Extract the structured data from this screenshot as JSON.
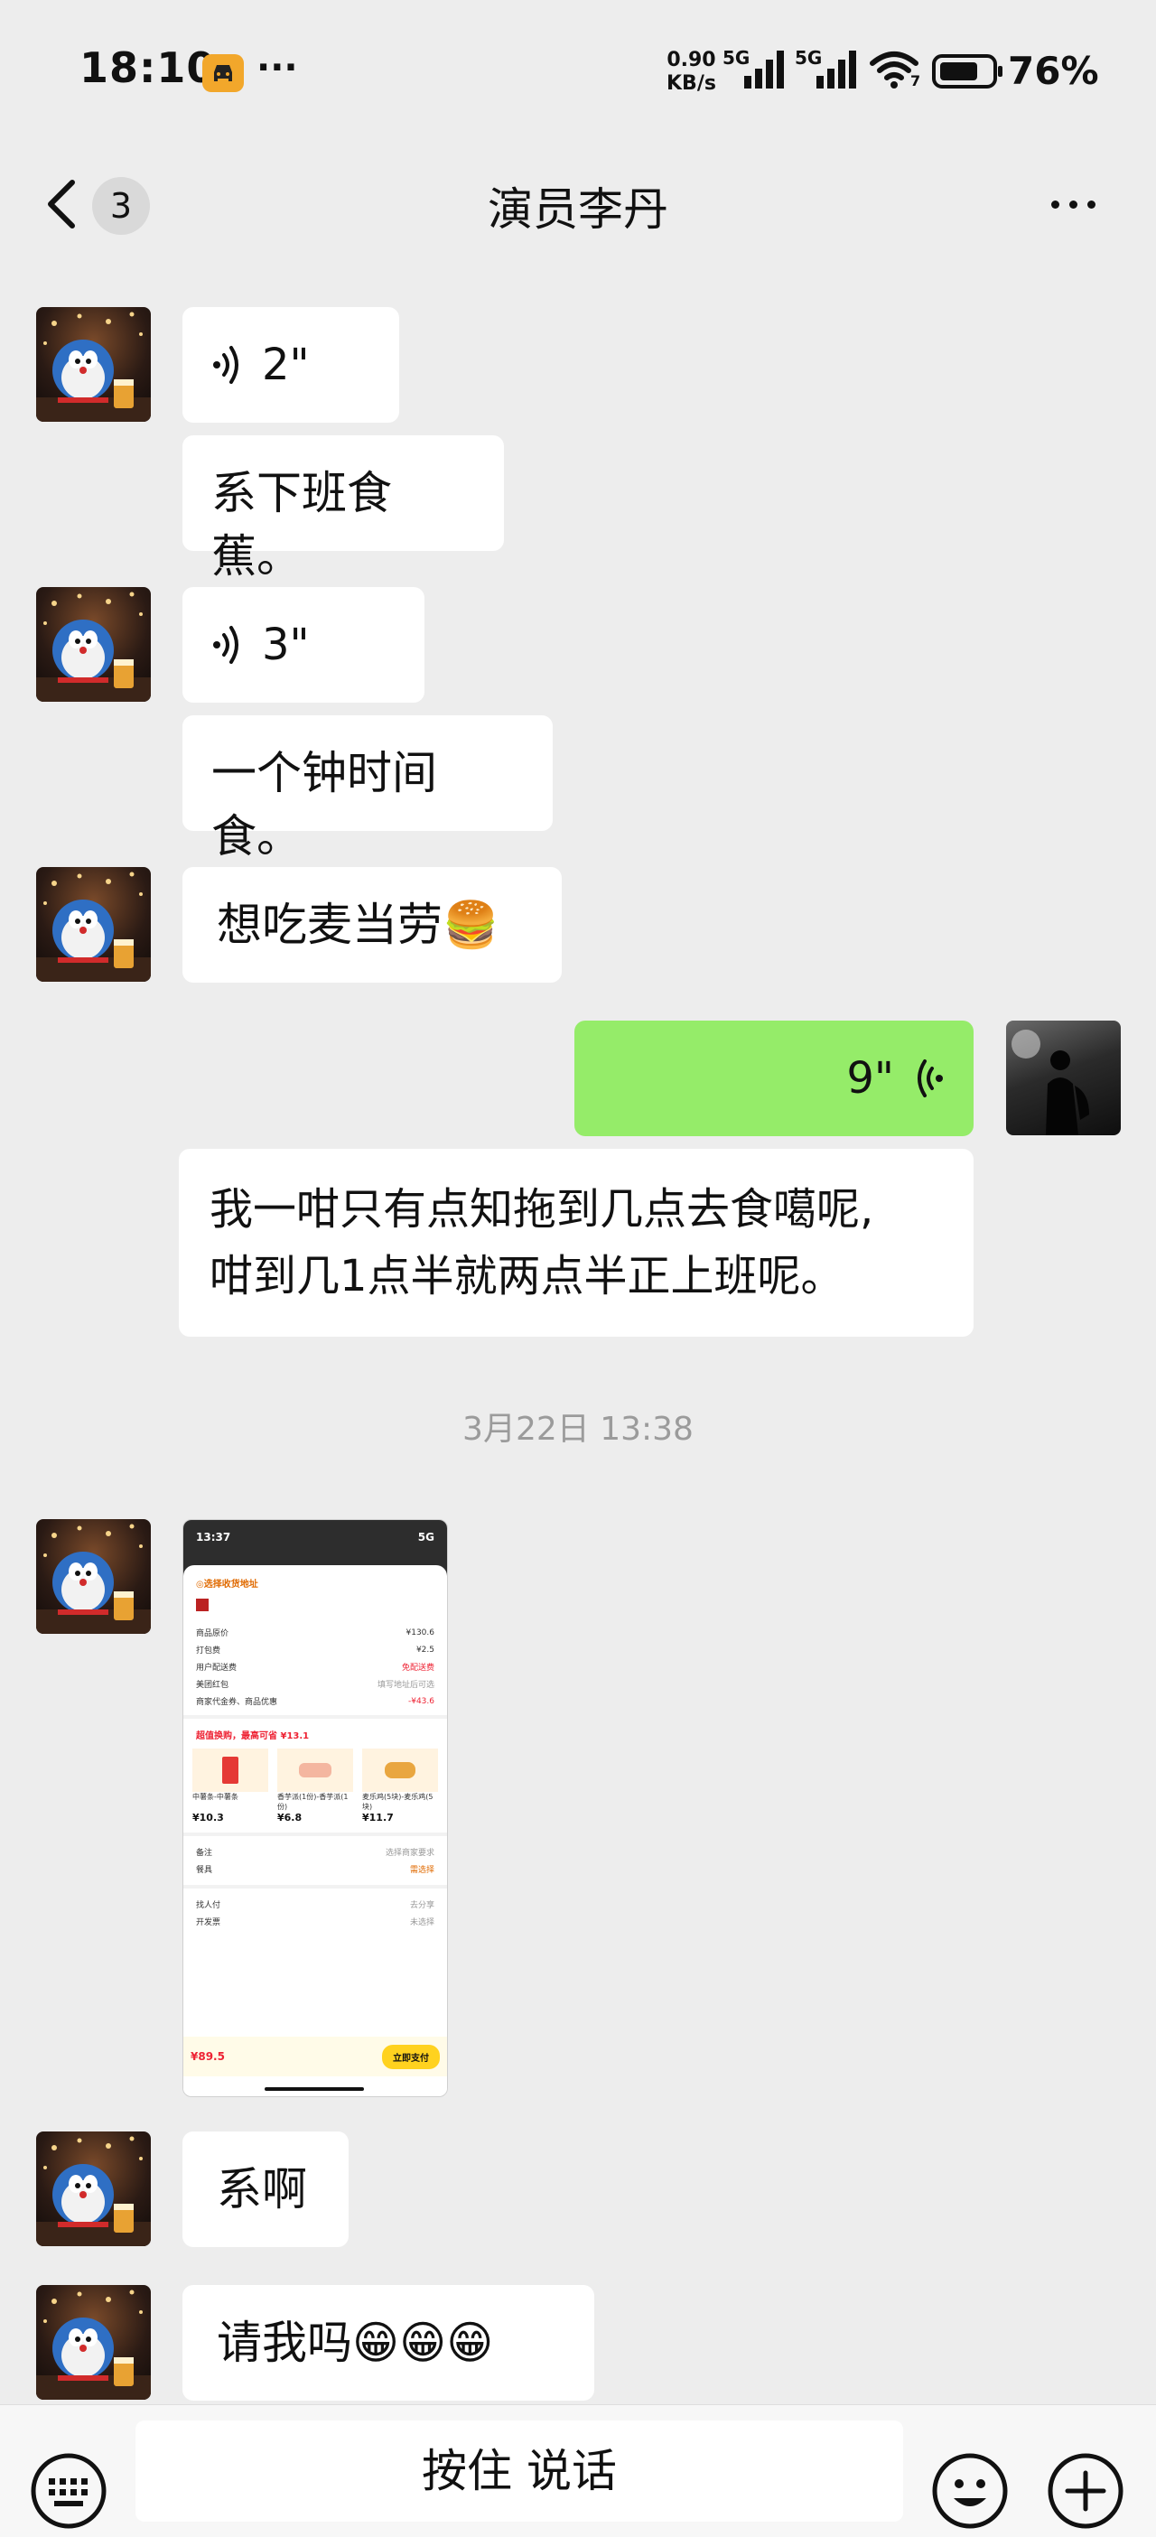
{
  "status_bar": {
    "time": "18:10",
    "dots": "···",
    "net_speed_value": "0.90",
    "net_speed_unit": "KB/s",
    "sig_label_1": "5G",
    "sig_label_2": "5G",
    "wifi_badge": "7",
    "battery": "76%",
    "battery_level": 0.76
  },
  "header": {
    "unread_count": "3",
    "title": "演员李丹"
  },
  "messages": [
    {
      "side": "left",
      "type": "voice",
      "duration": "2\""
    },
    {
      "side": "left",
      "type": "text",
      "text": "系下班食蕉。"
    },
    {
      "side": "left",
      "type": "voice",
      "duration": "3\""
    },
    {
      "side": "left",
      "type": "text",
      "text": "一个钟时间食。"
    },
    {
      "side": "left",
      "type": "text",
      "text": "想吃麦当劳🍔"
    },
    {
      "side": "right",
      "type": "voice",
      "duration": "9\""
    },
    {
      "side": "right",
      "type": "text",
      "line1": "我一咁只有点知拖到几点去食噶呢,",
      "line2": "咁到几1点半就两点半正上班呢。"
    },
    {
      "side": "left",
      "type": "image"
    },
    {
      "side": "left",
      "type": "text",
      "text": "系啊"
    },
    {
      "side": "left",
      "type": "text",
      "text": "请我吗😁😁😁"
    }
  ],
  "timestamp": "3月22日 13:38",
  "shared_screenshot": {
    "time": "13:37",
    "net": "5G",
    "address_prompt": "◎选择收货地址",
    "rows": [
      {
        "label": "商品原价",
        "value": "¥130.6"
      },
      {
        "label": "打包费",
        "value": "¥2.5"
      },
      {
        "label": "用户配送费",
        "value": "免配送费"
      },
      {
        "label": "美团红包",
        "value": "填写地址后可选"
      },
      {
        "label": "商家代金券、商品优惠",
        "value": "-¥43.6"
      }
    ],
    "deal_title": "超值换购，最高可省 ¥13.1",
    "items": [
      {
        "name": "中薯条-中薯条",
        "price": "¥10.3"
      },
      {
        "name": "香芋派(1份)-香芋派(1份)",
        "price": "¥6.8"
      },
      {
        "name": "麦乐鸡(5块)-麦乐鸡(5块)",
        "price": "¥11.7"
      }
    ],
    "rows2": [
      {
        "label": "备注",
        "value": "选择商家要求"
      },
      {
        "label": "餐具",
        "value": "需选择"
      },
      {
        "label": "找人付",
        "value": "去分享"
      },
      {
        "label": "开发票",
        "value": "未选择"
      }
    ],
    "total": "¥89.5",
    "pay_button": "立即支付"
  },
  "input_bar": {
    "talk_label": "按住 说话"
  },
  "colors": {
    "background": "#ededed",
    "bubble_left": "#ffffff",
    "bubble_right": "#95ec69",
    "timestamp": "#9b9b9b"
  },
  "icons": [
    "back-chevron-icon",
    "more-icon",
    "voice-wave-icon",
    "keyboard-icon",
    "emoji-icon",
    "plus-icon"
  ]
}
